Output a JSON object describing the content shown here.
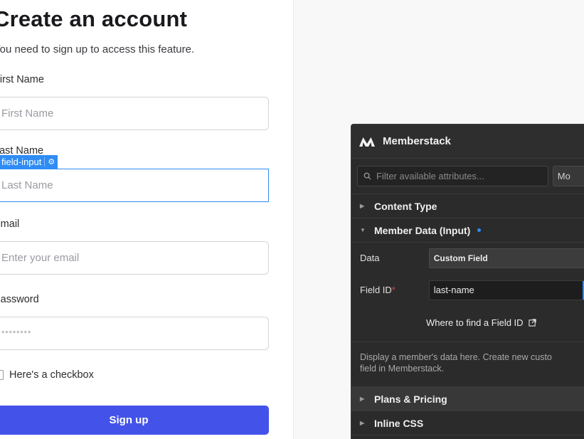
{
  "form": {
    "title": "Create an account",
    "subtitle": "You need to sign up to access this feature.",
    "first_name_label": "First Name",
    "first_name_placeholder": "First Name",
    "last_name_label": "Last Name",
    "last_name_placeholder": "Last Name",
    "selection_tag": "field-input",
    "email_label": "Email",
    "email_placeholder": "Enter your email",
    "password_label": "Password",
    "password_placeholder": "********",
    "checkbox_label": "Here's a checkbox",
    "signup_label": "Sign up"
  },
  "memberstack": {
    "title": "Memberstack",
    "search_placeholder": "Filter available attributes...",
    "more_label": "Mo",
    "sections": {
      "content_type": "Content Type",
      "member_data": "Member Data (Input)",
      "plans": "Plans & Pricing",
      "inline_css": "Inline CSS"
    },
    "data_label": "Data",
    "data_value": "Custom Field",
    "field_id_label": "Field ID",
    "field_id_required": "*",
    "field_id_value": "last-name",
    "where_to_find": "Where to find a Field ID",
    "description_line1": "Display a member's data here. Create new custo",
    "description_line2": "field in Memberstack."
  },
  "colors": {
    "accent_blue": "#2f8cf5",
    "signup_button": "#4353ea",
    "panel_bg": "#2b2b2b",
    "required_red": "#e9413f"
  }
}
